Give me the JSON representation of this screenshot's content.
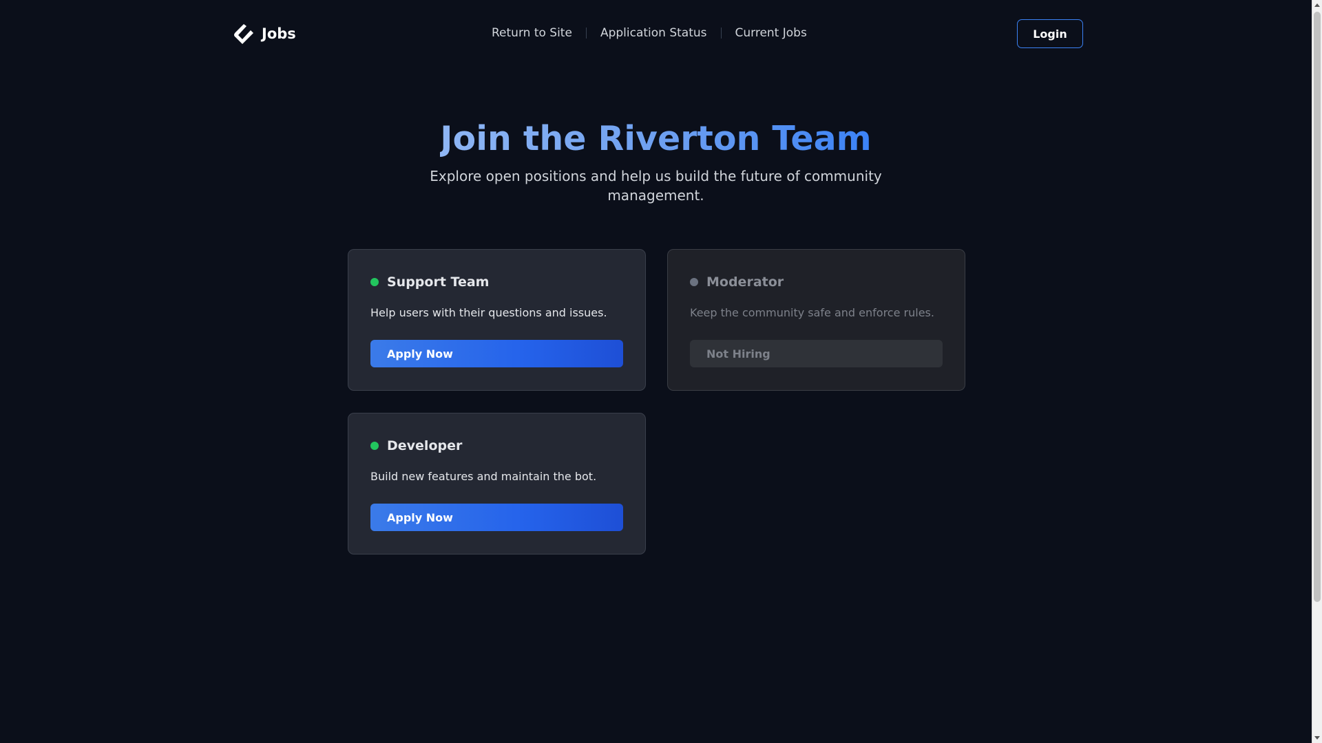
{
  "header": {
    "brand_name": "Jobs",
    "nav": [
      "Return to Site",
      "Application Status",
      "Current Jobs"
    ],
    "login_label": "Login"
  },
  "hero": {
    "title": "Join the Riverton Team",
    "subtitle": "Explore open positions and help us build the future of community management."
  },
  "jobs": [
    {
      "title": "Support Team",
      "description": "Help users with their questions and issues.",
      "button": "Apply Now",
      "status": "open"
    },
    {
      "title": "Moderator",
      "description": "Keep the community safe and enforce rules.",
      "button": "Not Hiring",
      "status": "closed"
    },
    {
      "title": "Developer",
      "description": "Build new features and maintain the bot.",
      "button": "Apply Now",
      "status": "open"
    }
  ],
  "colors": {
    "background": "#0b0f1a",
    "accent": "#2563eb",
    "open_status": "#22c55e",
    "closed_status": "#6b7280"
  }
}
